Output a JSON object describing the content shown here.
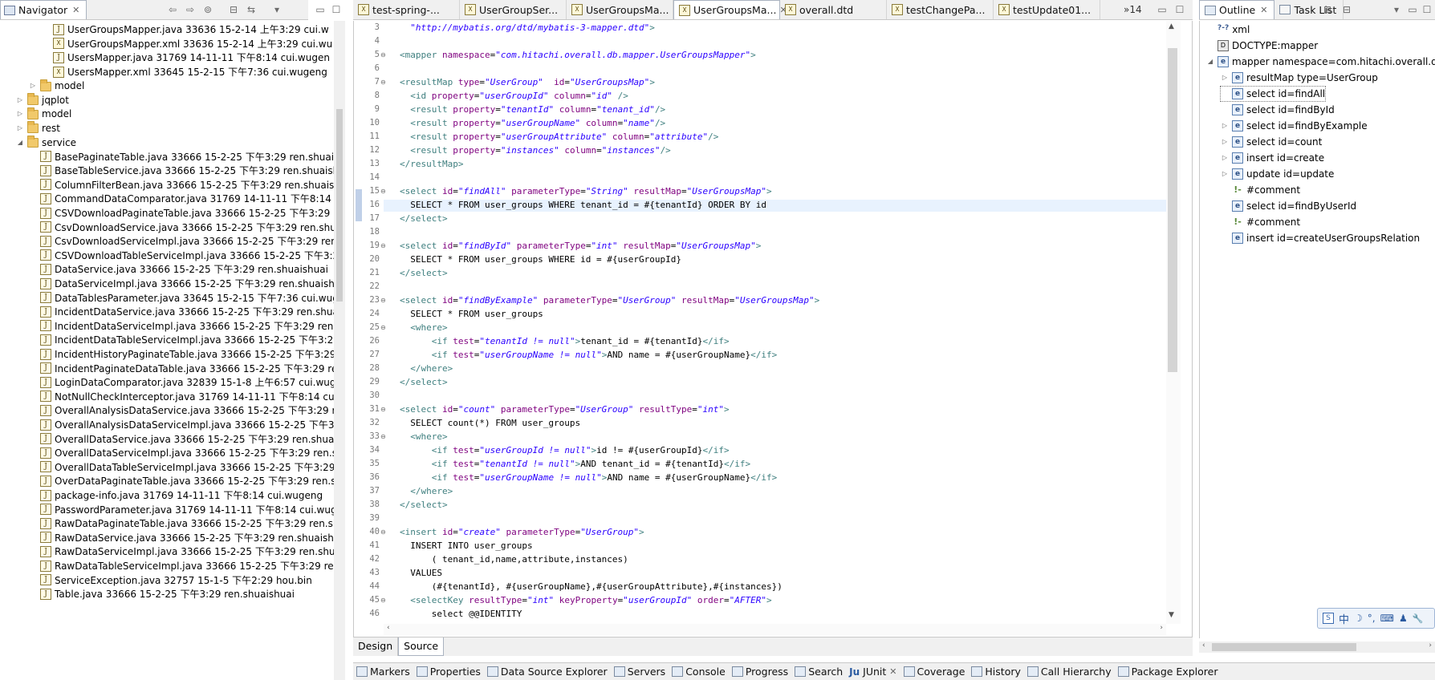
{
  "navigator": {
    "title": "Navigator",
    "tree": [
      {
        "label": "UserGroupsMapper.java 33636  15-2-14 上午3:29  cui.w",
        "icon": "java-file-icon",
        "indent": 3,
        "expander": ""
      },
      {
        "label": "UserGroupsMapper.xml 33636  15-2-14 上午3:29  cui.wu",
        "icon": "xml-file-icon",
        "indent": 3,
        "expander": ""
      },
      {
        "label": "UsersMapper.java 31769  14-11-11 下午8:14  cui.wugen",
        "icon": "java-file-icon",
        "indent": 3,
        "expander": ""
      },
      {
        "label": "UsersMapper.xml 33645  15-2-15 下午7:36  cui.wugeng",
        "icon": "xml-file-icon",
        "indent": 3,
        "expander": ""
      },
      {
        "label": "model",
        "icon": "folder-icon",
        "indent": 2,
        "expander": "▷"
      },
      {
        "label": "jqplot",
        "icon": "folder-icon",
        "indent": 1,
        "expander": "▷"
      },
      {
        "label": "model",
        "icon": "folder-icon",
        "indent": 1,
        "expander": "▷"
      },
      {
        "label": "rest",
        "icon": "folder-icon",
        "indent": 1,
        "expander": "▷"
      },
      {
        "label": "service",
        "icon": "folder-icon",
        "indent": 1,
        "expander": "◢"
      },
      {
        "label": "BasePaginateTable.java 33666  15-2-25 下午3:29  ren.shuais",
        "icon": "java-file-icon",
        "indent": 2,
        "expander": ""
      },
      {
        "label": "BaseTableService.java 33666  15-2-25 下午3:29  ren.shuaish",
        "icon": "java-file-icon",
        "indent": 2,
        "expander": ""
      },
      {
        "label": "ColumnFilterBean.java 33666  15-2-25 下午3:29  ren.shuaish",
        "icon": "java-file-icon",
        "indent": 2,
        "expander": ""
      },
      {
        "label": "CommandDataComparator.java 31769  14-11-11 下午8:14",
        "icon": "java-file-icon",
        "indent": 2,
        "expander": ""
      },
      {
        "label": "CSVDownloadPaginateTable.java 33666  15-2-25 下午3:29",
        "icon": "java-file-icon",
        "indent": 2,
        "expander": ""
      },
      {
        "label": "CsvDownloadService.java 33666  15-2-25 下午3:29  ren.shua",
        "icon": "java-file-icon",
        "indent": 2,
        "expander": ""
      },
      {
        "label": "CsvDownloadServiceImpl.java 33666  15-2-25 下午3:29  ren",
        "icon": "java-file-icon",
        "indent": 2,
        "expander": ""
      },
      {
        "label": "CSVDownloadTableServiceImpl.java 33666  15-2-25 下午3:2",
        "icon": "java-file-icon",
        "indent": 2,
        "expander": ""
      },
      {
        "label": "DataService.java 33666  15-2-25 下午3:29  ren.shuaishuai",
        "icon": "java-file-icon",
        "indent": 2,
        "expander": ""
      },
      {
        "label": "DataServiceImpl.java 33666  15-2-25 下午3:29  ren.shuaishu",
        "icon": "java-file-icon",
        "indent": 2,
        "expander": ""
      },
      {
        "label": "DataTablesParameter.java 33645  15-2-15 下午7:36  cui.wug",
        "icon": "java-file-icon",
        "indent": 2,
        "expander": ""
      },
      {
        "label": "IncidentDataService.java 33666  15-2-25 下午3:29  ren.shuai",
        "icon": "java-file-icon",
        "indent": 2,
        "expander": ""
      },
      {
        "label": "IncidentDataServiceImpl.java 33666  15-2-25 下午3:29  ren.s",
        "icon": "java-file-icon",
        "indent": 2,
        "expander": ""
      },
      {
        "label": "IncidentDataTableServiceImpl.java 33666  15-2-25 下午3:29",
        "icon": "java-file-icon",
        "indent": 2,
        "expander": ""
      },
      {
        "label": "IncidentHistoryPaginateTable.java 33666  15-2-25 下午3:29",
        "icon": "java-file-icon",
        "indent": 2,
        "expander": ""
      },
      {
        "label": "IncidentPaginateDataTable.java 33666  15-2-25 下午3:29  re",
        "icon": "java-file-icon",
        "indent": 2,
        "expander": ""
      },
      {
        "label": "LoginDataComparator.java 32839  15-1-8 上午6:57  cui.wug",
        "icon": "java-file-icon",
        "indent": 2,
        "expander": ""
      },
      {
        "label": "NotNullCheckInterceptor.java 31769  14-11-11 下午8:14  cu",
        "icon": "java-file-icon",
        "indent": 2,
        "expander": ""
      },
      {
        "label": "OverallAnalysisDataService.java 33666  15-2-25 下午3:29  re",
        "icon": "java-file-icon",
        "indent": 2,
        "expander": ""
      },
      {
        "label": "OverallAnalysisDataServiceImpl.java 33666  15-2-25 下午3:2",
        "icon": "java-file-icon",
        "indent": 2,
        "expander": ""
      },
      {
        "label": "OverallDataService.java 33666  15-2-25 下午3:29  ren.shuais",
        "icon": "java-file-icon",
        "indent": 2,
        "expander": ""
      },
      {
        "label": "OverallDataServiceImpl.java 33666  15-2-25 下午3:29  ren.sh",
        "icon": "java-file-icon",
        "indent": 2,
        "expander": ""
      },
      {
        "label": "OverallDataTableServiceImpl.java 33666  15-2-25 下午3:29",
        "icon": "java-file-icon",
        "indent": 2,
        "expander": ""
      },
      {
        "label": "OverDataPaginateTable.java 33666  15-2-25 下午3:29  ren.s",
        "icon": "java-file-icon",
        "indent": 2,
        "expander": ""
      },
      {
        "label": "package-info.java 31769  14-11-11 下午8:14  cui.wugeng",
        "icon": "java-file-icon",
        "indent": 2,
        "expander": ""
      },
      {
        "label": "PasswordParameter.java 31769  14-11-11 下午8:14  cui.wug",
        "icon": "java-file-icon",
        "indent": 2,
        "expander": ""
      },
      {
        "label": "RawDataPaginateTable.java 33666  15-2-25 下午3:29  ren.sh",
        "icon": "java-file-icon",
        "indent": 2,
        "expander": ""
      },
      {
        "label": "RawDataService.java 33666  15-2-25 下午3:29  ren.shuaishu",
        "icon": "java-file-icon",
        "indent": 2,
        "expander": ""
      },
      {
        "label": "RawDataServiceImpl.java 33666  15-2-25 下午3:29  ren.shua",
        "icon": "java-file-icon",
        "indent": 2,
        "expander": ""
      },
      {
        "label": "RawDataTableServiceImpl.java 33666  15-2-25 下午3:29  re",
        "icon": "java-file-icon",
        "indent": 2,
        "expander": ""
      },
      {
        "label": "ServiceException.java 32757  15-1-5 下午2:29  hou.bin",
        "icon": "java-file-icon",
        "indent": 2,
        "expander": ""
      },
      {
        "label": "Table.java 33666  15-2-25 下午3:29  ren.shuaishuai",
        "icon": "java-file-icon",
        "indent": 2,
        "expander": ""
      }
    ]
  },
  "editor": {
    "tabs": [
      {
        "label": "test-spring-...",
        "active": false
      },
      {
        "label": "UserGroupSer...",
        "active": false
      },
      {
        "label": "UserGroupsMa...",
        "active": false
      },
      {
        "label": "UserGroupsMa...",
        "active": true
      },
      {
        "label": "overall.dtd",
        "active": false
      },
      {
        "label": "testChangePa...",
        "active": false
      },
      {
        "label": "testUpdate01...",
        "active": false
      }
    ],
    "overflow_count": "»14",
    "bottom_tabs": [
      "Design",
      "Source"
    ],
    "active_bottom_tab": "Source",
    "lines": [
      {
        "n": "3",
        "fold": "",
        "html": "  <span class='val'>\"http://mybatis.org/dtd/mybatis-3-mapper.dtd\"</span><span class='tag'>&gt;</span>"
      },
      {
        "n": "4",
        "fold": "",
        "html": ""
      },
      {
        "n": "5",
        "fold": "⊖",
        "html": "<span class='tag'>&lt;mapper</span> <span class='attr'>namespace</span>=<span class='val'>\"com.hitachi.overall.db.mapper.UserGroupsMapper\"</span><span class='tag'>&gt;</span>"
      },
      {
        "n": "6",
        "fold": "",
        "html": ""
      },
      {
        "n": "7",
        "fold": "⊖",
        "html": "<span class='tag'>&lt;resultMap</span> <span class='attr'>type</span>=<span class='val'>\"UserGroup\"</span>  <span class='attr'>id</span>=<span class='val'>\"UserGroupsMap\"</span><span class='tag'>&gt;</span>"
      },
      {
        "n": "8",
        "fold": "",
        "html": "  <span class='tag'>&lt;id</span> <span class='attr'>property</span>=<span class='val'>\"userGroupId\"</span> <span class='attr'>column</span>=<span class='val'>\"id\"</span> <span class='tag'>/&gt;</span>"
      },
      {
        "n": "9",
        "fold": "",
        "html": "  <span class='tag'>&lt;result</span> <span class='attr'>property</span>=<span class='val'>\"tenantId\"</span> <span class='attr'>column</span>=<span class='val'>\"tenant_id\"</span><span class='tag'>/&gt;</span>"
      },
      {
        "n": "10",
        "fold": "",
        "html": "  <span class='tag'>&lt;result</span> <span class='attr'>property</span>=<span class='val'>\"userGroupName\"</span> <span class='attr'>column</span>=<span class='val'>\"name\"</span><span class='tag'>/&gt;</span>"
      },
      {
        "n": "11",
        "fold": "",
        "html": "  <span class='tag'>&lt;result</span> <span class='attr'>property</span>=<span class='val'>\"userGroupAttribute\"</span> <span class='attr'>column</span>=<span class='val'>\"attribute\"</span><span class='tag'>/&gt;</span>"
      },
      {
        "n": "12",
        "fold": "",
        "html": "  <span class='tag'>&lt;result</span> <span class='attr'>property</span>=<span class='val'>\"instances\"</span> <span class='attr'>column</span>=<span class='val'>\"instances\"</span><span class='tag'>/&gt;</span>"
      },
      {
        "n": "13",
        "fold": "",
        "html": "<span class='tag'>&lt;/resultMap&gt;</span>"
      },
      {
        "n": "14",
        "fold": "",
        "html": ""
      },
      {
        "n": "15",
        "fold": "⊖",
        "html": "<span class='tag'>&lt;select</span> <span class='attr'>id</span>=<span class='val'>\"findAll\"</span> <span class='attr'>parameterType</span>=<span class='val'>\"String\"</span> <span class='attr'>resultMap</span>=<span class='val'>\"UserGroupsMap\"</span><span class='tag'>&gt;</span>"
      },
      {
        "n": "16",
        "fold": "",
        "html": "  SELECT * FROM user_groups WHERE tenant_id = #{tenantId} ORDER BY id"
      },
      {
        "n": "17",
        "fold": "",
        "html": "<span class='tag'>&lt;/select&gt;</span>"
      },
      {
        "n": "18",
        "fold": "",
        "html": ""
      },
      {
        "n": "19",
        "fold": "⊖",
        "html": "<span class='tag'>&lt;select</span> <span class='attr'>id</span>=<span class='val'>\"findById\"</span> <span class='attr'>parameterType</span>=<span class='val'>\"int\"</span> <span class='attr'>resultMap</span>=<span class='val'>\"UserGroupsMap\"</span><span class='tag'>&gt;</span>"
      },
      {
        "n": "20",
        "fold": "",
        "html": "  SELECT * FROM user_groups WHERE id = #{userGroupId}"
      },
      {
        "n": "21",
        "fold": "",
        "html": "<span class='tag'>&lt;/select&gt;</span>"
      },
      {
        "n": "22",
        "fold": "",
        "html": ""
      },
      {
        "n": "23",
        "fold": "⊖",
        "html": "<span class='tag'>&lt;select</span> <span class='attr'>id</span>=<span class='val'>\"findByExample\"</span> <span class='attr'>parameterType</span>=<span class='val'>\"UserGroup\"</span> <span class='attr'>resultMap</span>=<span class='val'>\"UserGroupsMap\"</span><span class='tag'>&gt;</span>"
      },
      {
        "n": "24",
        "fold": "",
        "html": "  SELECT * FROM user_groups"
      },
      {
        "n": "25",
        "fold": "⊖",
        "html": "  <span class='tag'>&lt;where&gt;</span>"
      },
      {
        "n": "26",
        "fold": "",
        "html": "      <span class='tag'>&lt;if</span> <span class='attr'>test</span>=<span class='val'>\"tenantId != null\"</span><span class='tag'>&gt;</span>tenant_id = #{tenantId}<span class='tag'>&lt;/if&gt;</span>"
      },
      {
        "n": "27",
        "fold": "",
        "html": "      <span class='tag'>&lt;if</span> <span class='attr'>test</span>=<span class='val'>\"userGroupName != null\"</span><span class='tag'>&gt;</span>AND name = #{userGroupName}<span class='tag'>&lt;/if&gt;</span>"
      },
      {
        "n": "28",
        "fold": "",
        "html": "  <span class='tag'>&lt;/where&gt;</span>"
      },
      {
        "n": "29",
        "fold": "",
        "html": "<span class='tag'>&lt;/select&gt;</span>"
      },
      {
        "n": "30",
        "fold": "",
        "html": ""
      },
      {
        "n": "31",
        "fold": "⊖",
        "html": "<span class='tag'>&lt;select</span> <span class='attr'>id</span>=<span class='val'>\"count\"</span> <span class='attr'>parameterType</span>=<span class='val'>\"UserGroup\"</span> <span class='attr'>resultType</span>=<span class='val'>\"int\"</span><span class='tag'>&gt;</span>"
      },
      {
        "n": "32",
        "fold": "",
        "html": "  SELECT count(*) FROM user_groups"
      },
      {
        "n": "33",
        "fold": "⊖",
        "html": "  <span class='tag'>&lt;where&gt;</span>"
      },
      {
        "n": "34",
        "fold": "",
        "html": "      <span class='tag'>&lt;if</span> <span class='attr'>test</span>=<span class='val'>\"userGroupId != null\"</span><span class='tag'>&gt;</span>id != #{userGroupId}<span class='tag'>&lt;/if&gt;</span>"
      },
      {
        "n": "35",
        "fold": "",
        "html": "      <span class='tag'>&lt;if</span> <span class='attr'>test</span>=<span class='val'>\"tenantId != null\"</span><span class='tag'>&gt;</span>AND tenant_id = #{tenantId}<span class='tag'>&lt;/if&gt;</span>"
      },
      {
        "n": "36",
        "fold": "",
        "html": "      <span class='tag'>&lt;if</span> <span class='attr'>test</span>=<span class='val'>\"userGroupName != null\"</span><span class='tag'>&gt;</span>AND name = #{userGroupName}<span class='tag'>&lt;/if&gt;</span>"
      },
      {
        "n": "37",
        "fold": "",
        "html": "  <span class='tag'>&lt;/where&gt;</span>"
      },
      {
        "n": "38",
        "fold": "",
        "html": "<span class='tag'>&lt;/select&gt;</span>"
      },
      {
        "n": "39",
        "fold": "",
        "html": ""
      },
      {
        "n": "40",
        "fold": "⊖",
        "html": "<span class='tag'>&lt;insert</span> <span class='attr'>id</span>=<span class='val'>\"create\"</span> <span class='attr'>parameterType</span>=<span class='val'>\"UserGroup\"</span><span class='tag'>&gt;</span>"
      },
      {
        "n": "41",
        "fold": "",
        "html": "  INSERT INTO user_groups"
      },
      {
        "n": "42",
        "fold": "",
        "html": "      ( tenant_id,name,attribute,instances)"
      },
      {
        "n": "43",
        "fold": "",
        "html": "  VALUES"
      },
      {
        "n": "44",
        "fold": "",
        "html": "      (#{tenantId}, #{userGroupName},#{userGroupAttribute},#{instances})"
      },
      {
        "n": "45",
        "fold": "⊖",
        "html": "  <span class='tag'>&lt;selectKey</span> <span class='attr'>resultType</span>=<span class='val'>\"int\"</span> <span class='attr'>keyProperty</span>=<span class='val'>\"userGroupId\"</span> <span class='attr'>order</span>=<span class='val'>\"AFTER\"</span><span class='tag'>&gt;</span>"
      },
      {
        "n": "46",
        "fold": "",
        "html": "      select @@IDENTITY"
      }
    ],
    "highlight_line": "16"
  },
  "outline": {
    "tabs": [
      "Outline",
      "Task List"
    ],
    "items": [
      {
        "label": "xml",
        "icon": "processing-instruction-icon",
        "indent": 0,
        "expander": ""
      },
      {
        "label": "DOCTYPE:mapper",
        "icon": "doctype-icon",
        "indent": 0,
        "expander": ""
      },
      {
        "label": "mapper namespace=com.hitachi.overall.db",
        "icon": "element-icon",
        "indent": 0,
        "expander": "◢"
      },
      {
        "label": "resultMap type=UserGroup",
        "icon": "element-icon",
        "indent": 1,
        "expander": "▷"
      },
      {
        "label": "select id=findAll",
        "icon": "element-icon",
        "indent": 1,
        "expander": "",
        "selected": true
      },
      {
        "label": "select id=findById",
        "icon": "element-icon",
        "indent": 1,
        "expander": ""
      },
      {
        "label": "select id=findByExample",
        "icon": "element-icon",
        "indent": 1,
        "expander": "▷"
      },
      {
        "label": "select id=count",
        "icon": "element-icon",
        "indent": 1,
        "expander": "▷"
      },
      {
        "label": "insert id=create",
        "icon": "element-icon",
        "indent": 1,
        "expander": "▷"
      },
      {
        "label": "update id=update",
        "icon": "element-icon",
        "indent": 1,
        "expander": "▷"
      },
      {
        "label": "#comment",
        "icon": "comment-icon",
        "indent": 1,
        "expander": ""
      },
      {
        "label": "select id=findByUserId",
        "icon": "element-icon",
        "indent": 1,
        "expander": ""
      },
      {
        "label": "#comment",
        "icon": "comment-icon",
        "indent": 1,
        "expander": ""
      },
      {
        "label": "insert id=createUserGroupsRelation",
        "icon": "element-icon",
        "indent": 1,
        "expander": ""
      }
    ]
  },
  "ime_toolbar": {
    "items": [
      "中",
      "☽",
      "°,",
      "⌨",
      "♟",
      "🔧"
    ]
  },
  "bottom_panel": {
    "tabs": [
      {
        "label": "Markers",
        "icon": "markers-icon"
      },
      {
        "label": "Properties",
        "icon": "properties-icon"
      },
      {
        "label": "Data Source Explorer",
        "icon": "data-source-icon"
      },
      {
        "label": "Servers",
        "icon": "servers-icon"
      },
      {
        "label": "Console",
        "icon": "console-icon"
      },
      {
        "label": "Progress",
        "icon": "progress-icon"
      },
      {
        "label": "Search",
        "icon": "search-icon"
      },
      {
        "label": "JUnit",
        "icon": "junit-icon",
        "prefix": "Ju",
        "closable": true
      },
      {
        "label": "Coverage",
        "icon": "coverage-icon"
      },
      {
        "label": "History",
        "icon": "history-icon"
      },
      {
        "label": "Call Hierarchy",
        "icon": "call-hierarchy-icon"
      },
      {
        "label": "Package Explorer",
        "icon": "package-explorer-icon"
      }
    ]
  }
}
